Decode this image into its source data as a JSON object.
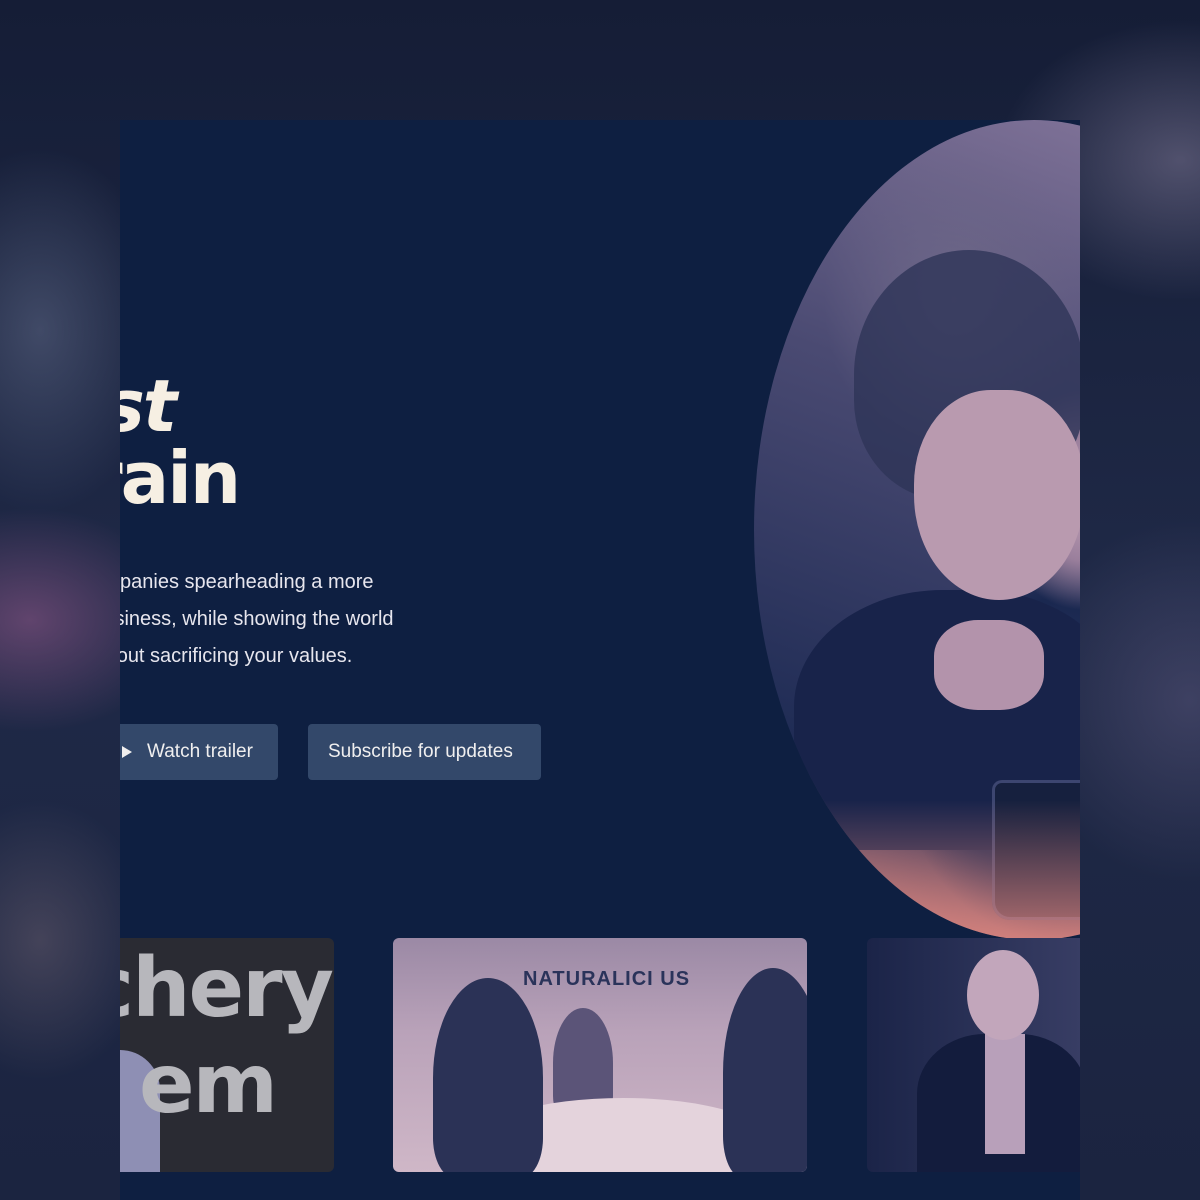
{
  "hero": {
    "title_line1": "inst",
    "title_line2": "Grain",
    "description": [
      "of companies spearheading a more",
      "ing business, while showing the world",
      "ul without sacrificing your values."
    ]
  },
  "buttons": {
    "watch_trailer": "Watch trailer",
    "subscribe": "Subscribe for updates"
  },
  "thumbnails": [
    {
      "text_line1": "chery",
      "text_line2": "em"
    },
    {
      "sign": "NATURALICI  US"
    },
    {}
  ],
  "colors": {
    "page_background": "#0e1f41",
    "title_text": "#f6efe3",
    "button_background": "#33486a",
    "hero_glow": "#e98b80"
  },
  "icons": {
    "play": "play-icon"
  }
}
